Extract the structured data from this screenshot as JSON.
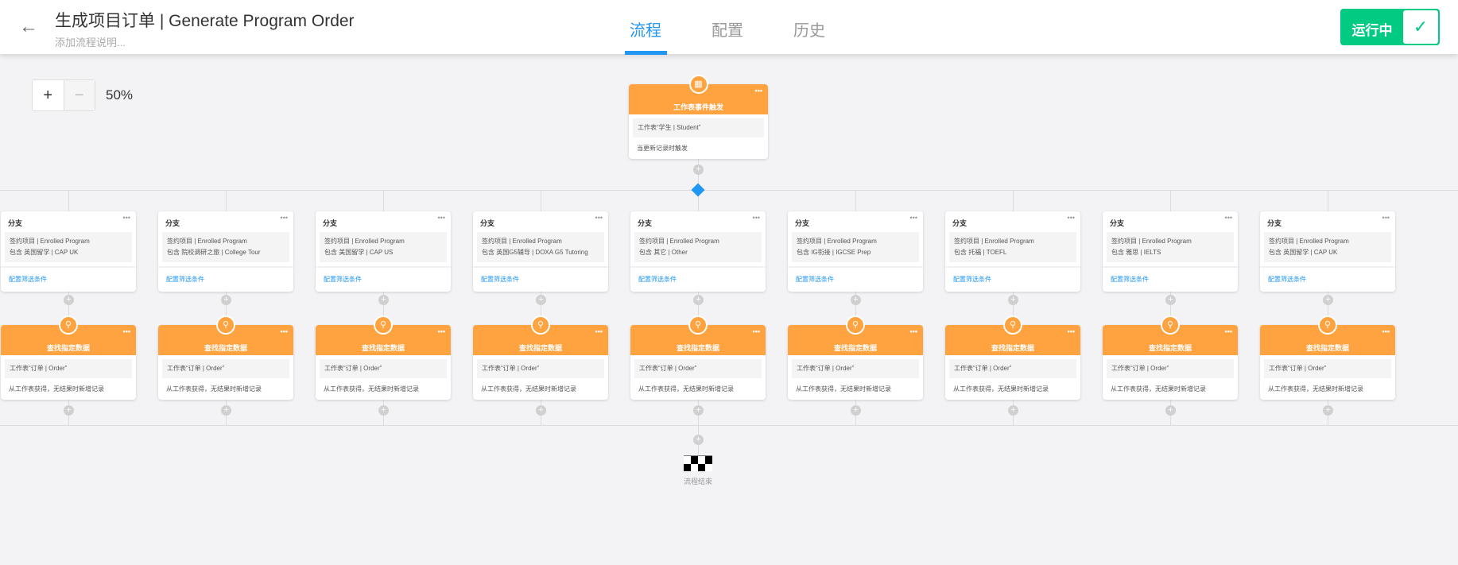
{
  "header": {
    "title": "生成项目订单 | Generate Program Order",
    "description": "添加流程说明...",
    "tabs": [
      "流程",
      "配置",
      "历史"
    ],
    "status": "运行中"
  },
  "zoom": {
    "plus": "+",
    "minus": "−",
    "level": "50%"
  },
  "trigger": {
    "title": "工作表事件触发",
    "sheet": "工作表“学生 | Student”",
    "condition": "当更新记录时触发"
  },
  "branches": [
    {
      "title": "分支",
      "field": "签约项目 | Enrolled Program",
      "value": "包含 英国留学 | CAP UK",
      "link": "配置筛选条件"
    },
    {
      "title": "分支",
      "field": "签约项目 | Enrolled Program",
      "value": "包含 院校调研之旅 | College Tour",
      "link": "配置筛选条件"
    },
    {
      "title": "分支",
      "field": "签约项目 | Enrolled Program",
      "value": "包含 美国留学 | CAP US",
      "link": "配置筛选条件"
    },
    {
      "title": "分支",
      "field": "签约项目 | Enrolled Program",
      "value": "包含 英国G5辅导 | DOXA G5 Tutoring",
      "link": "配置筛选条件"
    },
    {
      "title": "分支",
      "field": "签约项目 | Enrolled Program",
      "value": "包含 其它 | Other",
      "link": "配置筛选条件"
    },
    {
      "title": "分支",
      "field": "签约项目 | Enrolled Program",
      "value": "包含 IG衔接 | IGCSE Prep",
      "link": "配置筛选条件"
    },
    {
      "title": "分支",
      "field": "签约项目 | Enrolled Program",
      "value": "包含 托福 | TOEFL",
      "link": "配置筛选条件"
    },
    {
      "title": "分支",
      "field": "签约项目 | Enrolled Program",
      "value": "包含 雅思 | IELTS",
      "link": "配置筛选条件"
    },
    {
      "title": "分支",
      "field": "签约项目 | Enrolled Program",
      "value": "包含 英国留学 | CAP UK",
      "link": "配置筛选条件"
    }
  ],
  "find": {
    "title": "查找指定数据",
    "sheet": "工作表“订单 | Order”",
    "desc": "从工作表获得，无结果时新增记录"
  },
  "end": {
    "label": "流程结束"
  }
}
